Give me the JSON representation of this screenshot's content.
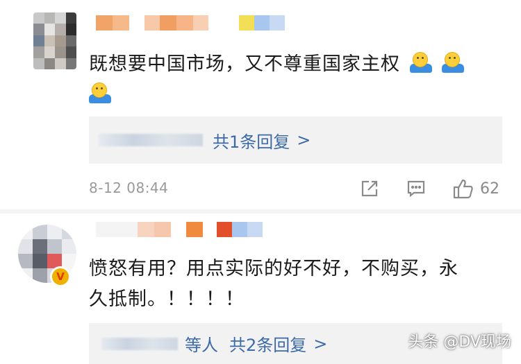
{
  "comments": [
    {
      "text_line1": "既想要中国市场，又不尊重国家主权",
      "emoji_icon": "shrug-emoji-icon",
      "reply_link": "共1条回复",
      "reply_chevron": ">",
      "timestamp": "8-12 08:44",
      "likes": "62"
    },
    {
      "text_line1": "愤怒有用？用点实际的好不好，不购买，永",
      "text_line2": "久抵制。！！！！",
      "reply_name_suffix": "等人",
      "reply_link": "共2条回复",
      "reply_chevron": ">"
    }
  ],
  "watermark": "头条 @DV现场",
  "colors": {
    "link": "#3c6aa8",
    "meta": "#999999",
    "reply_bg": "#f2f2f2",
    "verified_badge": "#f0b000"
  }
}
